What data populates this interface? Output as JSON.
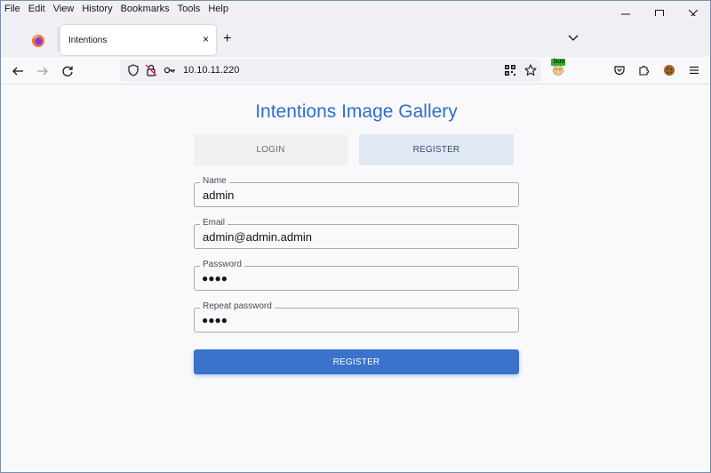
{
  "menu": {
    "file": "File",
    "edit": "Edit",
    "view": "View",
    "history": "History",
    "bookmarks": "Bookmarks",
    "tools": "Tools",
    "help": "Help"
  },
  "browser": {
    "tab_title": "Intentions",
    "tab_close": "×",
    "new_tab": "+",
    "url": "10.10.11.220",
    "extension_badge": "bun"
  },
  "page": {
    "title": "Intentions Image Gallery",
    "tab_login": "LOGIN",
    "tab_register": "REGISTER",
    "name_label": "Name",
    "name_value": "admin",
    "email_label": "Email",
    "email_value": "admin@admin.admin",
    "password_label": "Password",
    "password_value": "●●●●",
    "repeat_label": "Repeat password",
    "repeat_value": "●●●●",
    "submit_label": "REGISTER"
  },
  "colors": {
    "accent": "#2f6fcb",
    "button": "#3a72cc",
    "active_tab_bg": "#e0e8f4"
  }
}
